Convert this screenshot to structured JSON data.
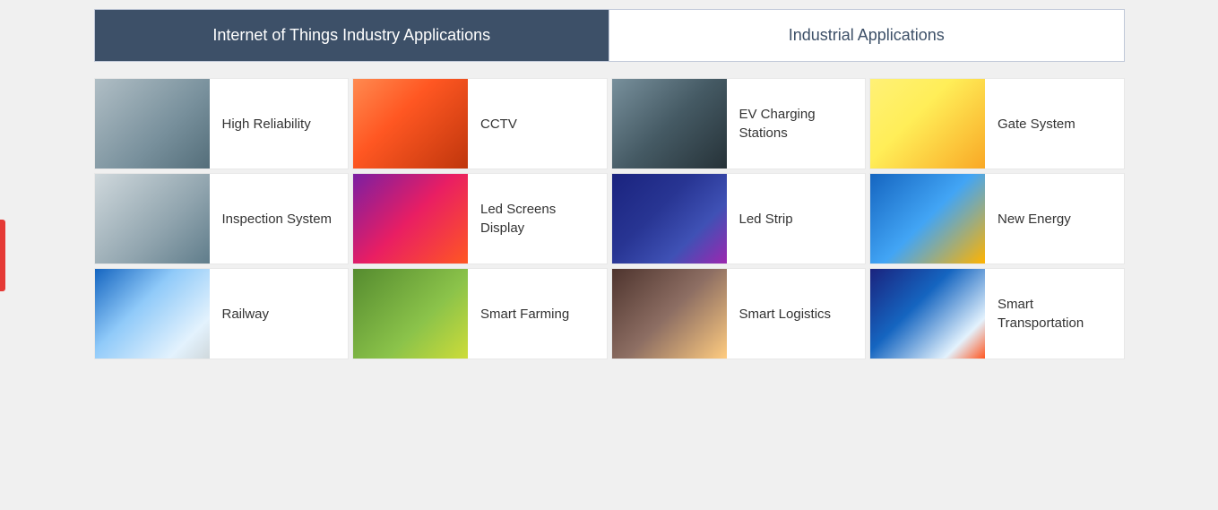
{
  "tabs": [
    {
      "id": "iot",
      "label": "Internet of Things Industry Applications",
      "active": true
    },
    {
      "id": "industrial",
      "label": "Industrial Applications",
      "active": false
    }
  ],
  "cards": [
    {
      "id": "high-reliability",
      "label": "High Reliability",
      "imgClass": "img-high-reliability"
    },
    {
      "id": "cctv",
      "label": "CCTV",
      "imgClass": "img-cctv"
    },
    {
      "id": "ev-charging",
      "label": "EV Charging Stations",
      "imgClass": "img-ev-charging"
    },
    {
      "id": "gate-system",
      "label": "Gate System",
      "imgClass": "img-gate-system"
    },
    {
      "id": "inspection-system",
      "label": "Inspection System",
      "imgClass": "img-inspection"
    },
    {
      "id": "led-screens-display",
      "label": "Led Screens Display",
      "imgClass": "img-led-screens"
    },
    {
      "id": "led-strip",
      "label": "Led Strip",
      "imgClass": "img-led-strip"
    },
    {
      "id": "new-energy",
      "label": "New Energy",
      "imgClass": "img-new-energy"
    },
    {
      "id": "railway",
      "label": "Railway",
      "imgClass": "img-railway"
    },
    {
      "id": "smart-farming",
      "label": "Smart Farming",
      "imgClass": "img-smart-farming"
    },
    {
      "id": "smart-logistics",
      "label": "Smart Logistics",
      "imgClass": "img-smart-logistics"
    },
    {
      "id": "smart-transportation",
      "label": "Smart Transportation",
      "imgClass": "img-smart-transportation"
    }
  ]
}
